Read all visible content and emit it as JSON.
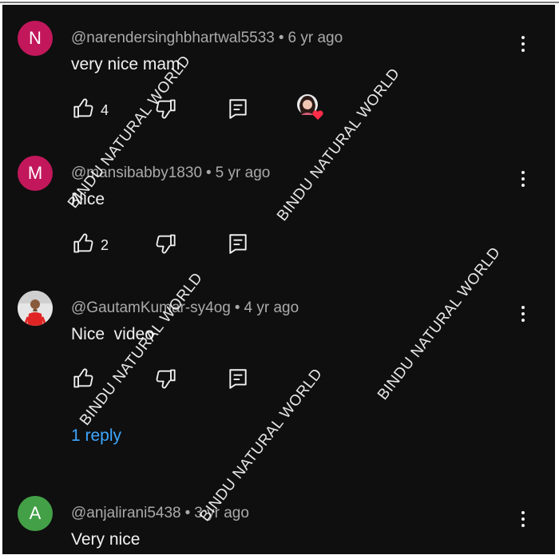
{
  "watermark": "BINDU NATURAL WORLD",
  "comments": [
    {
      "avatar_letter": "N",
      "avatar_color": "#c2185b",
      "handle": "@narendersinghbhartwal5533",
      "age": "6 yr ago",
      "text": "very nice mam",
      "likes": "4",
      "creator_heart": true
    },
    {
      "avatar_letter": "M",
      "avatar_color": "#c2185b",
      "handle": "@mansibabby1830",
      "age": "5 yr ago",
      "text": "Nice",
      "likes": "2"
    },
    {
      "avatar_letter": "",
      "handle": "@GautamKumar-sy4og",
      "age": "4 yr ago",
      "text": "Nice  video",
      "likes": "",
      "reply_link": "1 reply"
    },
    {
      "avatar_letter": "A",
      "avatar_color": "#43a047",
      "handle": "@anjalirani5438",
      "age": "3 yr ago",
      "text": "Very nice"
    }
  ]
}
